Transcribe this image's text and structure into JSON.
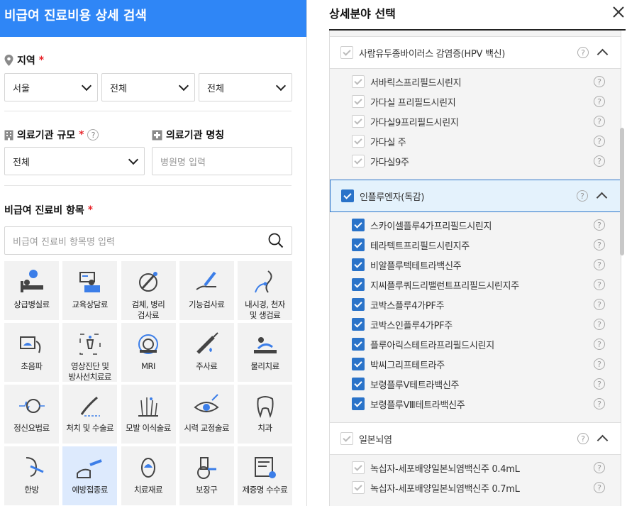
{
  "left": {
    "header_title": "비급여 진료비용 상세 검색",
    "region_label": "지역",
    "required_mark": "*",
    "region_selects": [
      "서울",
      "전체",
      "전체"
    ],
    "scale_label": "의료기관 규모",
    "scale_select": "전체",
    "name_label": "의료기관 명칭",
    "name_placeholder": "병원명 입력",
    "items_label": "비급여 진료비 항목",
    "search_placeholder": "비급여 진료비 항목명 입력",
    "help_glyph": "?",
    "categories": [
      {
        "label": "상급병실료",
        "icon": "hospital-bed-icon"
      },
      {
        "label": "교육상담료",
        "icon": "consultation-icon"
      },
      {
        "label": "검체, 병리\n검사료",
        "icon": "specimen-test-icon"
      },
      {
        "label": "기능검사료",
        "icon": "function-test-icon"
      },
      {
        "label": "내시경, 천자\n및 생검료",
        "icon": "endoscope-icon"
      },
      {
        "label": "초음파",
        "icon": "ultrasound-icon"
      },
      {
        "label": "영상진단 및\n방사선치료료",
        "icon": "imaging-icon"
      },
      {
        "label": "MRI",
        "icon": "mri-icon"
      },
      {
        "label": "주사료",
        "icon": "injection-icon"
      },
      {
        "label": "물리치료",
        "icon": "physical-therapy-icon"
      },
      {
        "label": "정신요법료",
        "icon": "psychotherapy-icon"
      },
      {
        "label": "처치 및 수술료",
        "icon": "surgery-icon"
      },
      {
        "label": "모발 이식술료",
        "icon": "hair-transplant-icon"
      },
      {
        "label": "시력 교정술료",
        "icon": "vision-correction-icon"
      },
      {
        "label": "치과",
        "icon": "tooth-icon"
      },
      {
        "label": "한방",
        "icon": "oriental-medicine-icon"
      },
      {
        "label": "예방접종료",
        "icon": "vaccination-icon",
        "selected": true
      },
      {
        "label": "치료재료",
        "icon": "treatment-material-icon"
      },
      {
        "label": "보장구",
        "icon": "wheelchair-icon"
      },
      {
        "label": "제증명 수수료",
        "icon": "certificate-icon"
      }
    ]
  },
  "right": {
    "title": "상세분야 선택",
    "groups": [
      {
        "label": "사람유두종바이러스 감염증(HPV 백신)",
        "checked": false,
        "active": false,
        "children": [
          {
            "label": "서바릭스프리필드시린지",
            "checked": false
          },
          {
            "label": "가다실 프리필드시린지",
            "checked": false
          },
          {
            "label": "가다실9프리필드시린지",
            "checked": false
          },
          {
            "label": "가다실 주",
            "checked": false
          },
          {
            "label": "가다실9주",
            "checked": false
          }
        ]
      },
      {
        "label": "인플루엔자(독감)",
        "checked": true,
        "active": true,
        "children": [
          {
            "label": "스카이셀플루4가프리필드시린지",
            "checked": true
          },
          {
            "label": "테라텍트프리필드시린지주",
            "checked": true
          },
          {
            "label": "비알플루텍테트라백신주",
            "checked": true
          },
          {
            "label": "지씨플루쿼드리밸런트프리필드시린지주",
            "checked": true
          },
          {
            "label": "코박스플루4가PF주",
            "checked": true
          },
          {
            "label": "코박스인플루4가PF주",
            "checked": true
          },
          {
            "label": "플루아릭스테트라프리필드시린지",
            "checked": true
          },
          {
            "label": "박씨그리프테트라주",
            "checked": true
          },
          {
            "label": "보령플루Ⅴ테트라백신주",
            "checked": true
          },
          {
            "label": "보령플루Ⅷ테트라백신주",
            "checked": true
          }
        ]
      },
      {
        "label": "일본뇌염",
        "checked": false,
        "active": false,
        "children": [
          {
            "label": "녹십자-세포배양일본뇌염백신주 0.4mL",
            "checked": false
          },
          {
            "label": "녹십자-세포배양일본뇌염백신주 0.7mL",
            "checked": false
          }
        ]
      }
    ]
  }
}
